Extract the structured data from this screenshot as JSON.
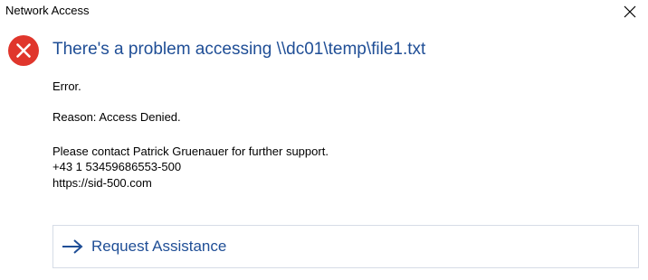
{
  "window": {
    "title": "Network Access",
    "close_icon": "close-icon"
  },
  "message": {
    "icon": "error-icon",
    "heading": "There's a problem accessing \\\\dc01\\temp\\file1.txt",
    "error_line": "Error.",
    "reason_line": "Reason: Access Denied.",
    "contact_line": "Please contact Patrick Gruenauer for further support.",
    "phone_line": "+43 1 53459686553-500",
    "url_line": "https://sid-500.com"
  },
  "actions": {
    "request_label": "Request Assistance",
    "request_icon": "arrow-right-icon"
  },
  "colors": {
    "accent": "#1f4e96",
    "error_red": "#e0362c"
  }
}
